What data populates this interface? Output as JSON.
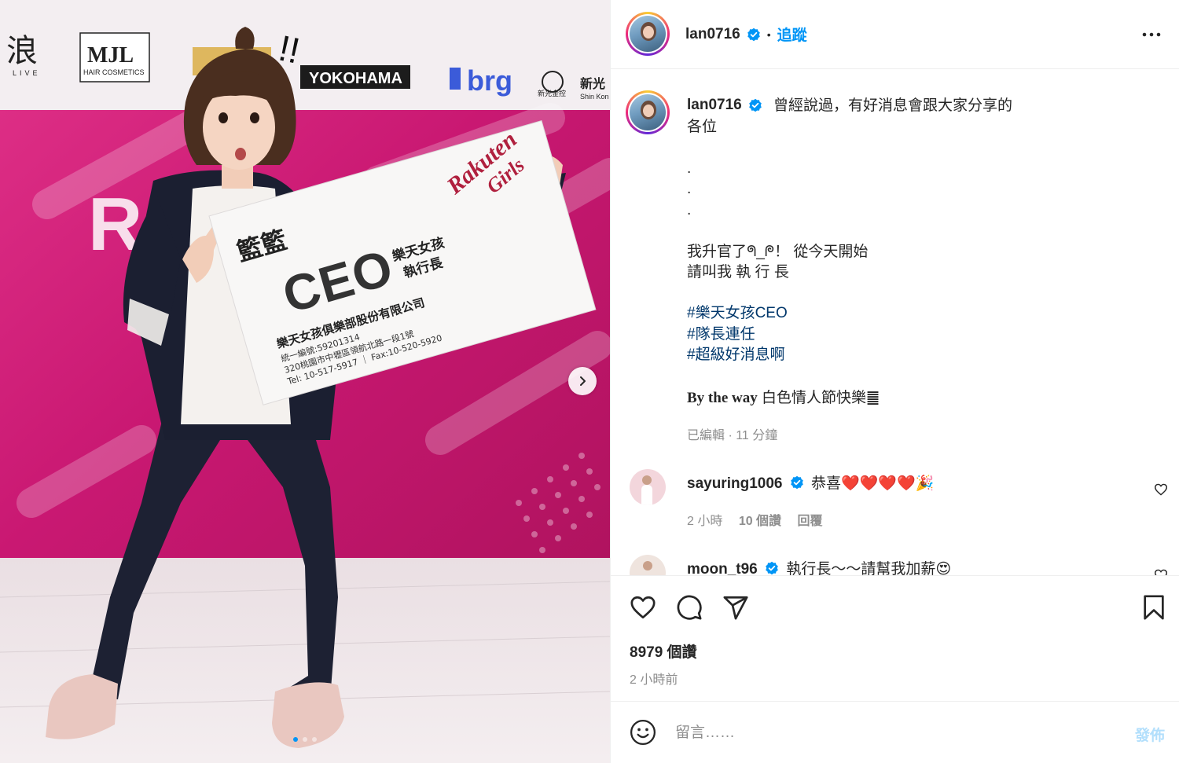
{
  "colors": {
    "accent": "#0095f6",
    "hashtag": "#00376b",
    "muted": "#8e8e8e",
    "backdrop": "#c2195f"
  },
  "media": {
    "sponsors": [
      "浪",
      "LIVE",
      "MJL",
      "HAIR COSMETICS",
      "YOKOHAMA",
      "brg",
      "新光金控",
      "新光",
      "Shin Kon"
    ],
    "sign": {
      "name": "籃籃",
      "title": "CEO",
      "role_line1": "樂天女孩",
      "role_line2": "執行長",
      "company": "樂天女孩俱樂部股份有限公司",
      "tax_id": "統一編號:59201314",
      "address": "320桃園市中壢區領航北路一段1號",
      "contact": "Tel: 10-517-5917 ｜ Fax:10-520-5920",
      "brand_line1": "Rakuten",
      "brand_line2": "Girls"
    },
    "doodle": "!!",
    "carousel_index": 1,
    "carousel_count": 3
  },
  "header": {
    "username": "lan0716",
    "separator": "•",
    "follow_label": "追蹤",
    "more_icon": "more-horizontal-icon"
  },
  "caption": {
    "username": "lan0716",
    "text": "曾經說過，有好消息會跟大家分享的\n各位\n\n.\n.\n.\n\n我升官了ᖗ_ᖘ！ 從今天開始\n請叫我 執 行 長",
    "hashtags": [
      "#樂天女孩CEO",
      "#隊長連任",
      "#超級好消息啊"
    ],
    "btw_en": "By the way",
    "btw_zh": " 白色情人節快樂䷀",
    "edited": "已編輯 · 11 分鐘"
  },
  "comments": [
    {
      "username": "sayuring1006",
      "text": "恭喜❤️❤️❤️❤️🎉",
      "time": "2 小時",
      "likes": "10 個讚",
      "reply": "回覆"
    },
    {
      "username": "moon_t96",
      "text": "執行長～～請幫我加薪😍"
    }
  ],
  "actions": {
    "likes": "8979 個讚",
    "posted": "2 小時前"
  },
  "comment_box": {
    "placeholder": "留言……",
    "post_label": "發佈"
  }
}
